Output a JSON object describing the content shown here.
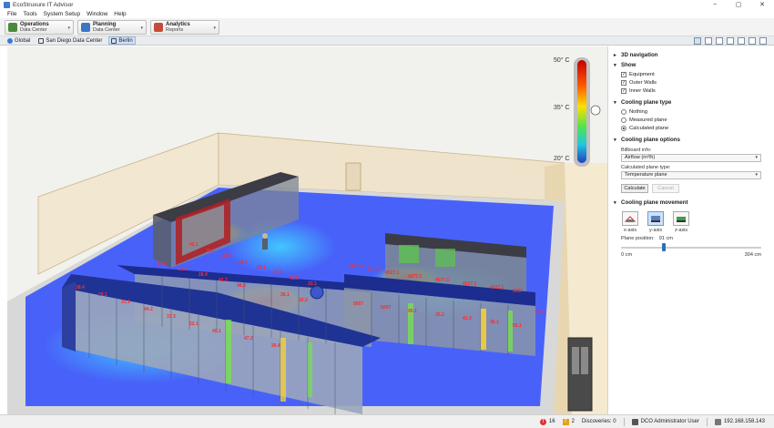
{
  "window": {
    "title": "EcoStruxure IT Advisor",
    "controls": [
      "−",
      "▢",
      "✕"
    ]
  },
  "menu": [
    "File",
    "Tools",
    "System Setup",
    "Window",
    "Help"
  ],
  "toolbar": {
    "operations": {
      "title": "Operations",
      "sub": "Data Center"
    },
    "planning": {
      "title": "Planning",
      "sub": "Data Center"
    },
    "analytics": {
      "title": "Analytics",
      "sub": "Reports"
    }
  },
  "tabs": {
    "global": "Global",
    "sandiego": "San Diego Data Center",
    "berlin": "Berlin"
  },
  "legend": {
    "max": "50° C",
    "mid": "35° C",
    "min": "20° C"
  },
  "racks": {
    "labels": [
      "4527.1",
      "4377.1",
      "4527.1",
      "4377.1",
      "4577.1",
      "4527.1",
      "4527.1",
      "5007",
      "5007",
      "5007"
    ],
    "numbers": [
      "45.1",
      "35.2",
      "43.3",
      "46.1",
      "55.1",
      "39.3",
      "42.3",
      "33.1",
      "34.5",
      "50.4",
      "28.4",
      "41.2",
      "48.2",
      "36.1",
      "30.2",
      "38.4",
      "29.1",
      "31.1",
      "44.2",
      "37.3",
      "52.1",
      "40.1",
      "47.2",
      "26.4"
    ]
  },
  "panel": {
    "nav": "3D navigation",
    "show": "Show",
    "show_items": [
      "Equipment",
      "Outer Walls",
      "Inner Walls"
    ],
    "cooling_type": "Cooling plane type",
    "type_items": [
      "Nothing",
      "Measured plane",
      "Calculated plane"
    ],
    "options": "Cooling plane options",
    "billboard_label": "Billboard info:",
    "billboard_value": "Airflow (m³/h)",
    "calc_label": "Calculated plane type:",
    "calc_value": "Temperature plane",
    "calculate": "Calculate",
    "cancel": "Cancel",
    "movement": "Cooling plane movement",
    "axes": [
      "x-axis",
      "y-axis",
      "z-axis"
    ],
    "plane_position_label": "Plane position:",
    "plane_position_value": "91 cm",
    "plane_fraction": 0.3,
    "min": "0 cm",
    "max": "304 cm"
  },
  "status": {
    "errors": "16",
    "warnings": "2",
    "discoveries": "Discoveries: 0",
    "user": "DCO Administrator User",
    "ip": "192.168.158.143"
  }
}
